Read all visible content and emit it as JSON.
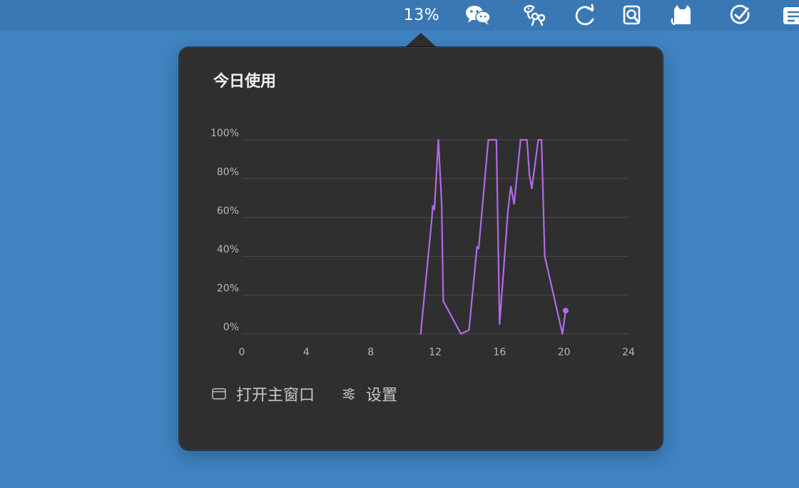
{
  "menubar": {
    "cpu_readout": "13%",
    "icons": [
      "wechat-icon",
      "chatbot-icon",
      "sync-icon",
      "magnifier-icon",
      "cat-icon",
      "checkmark-icon",
      "notes-icon"
    ]
  },
  "popover": {
    "title": "今日使用",
    "actions": {
      "open_main_window": "打开主窗口",
      "settings": "设置"
    }
  },
  "colors": {
    "desktop_bg": "#3f83c1",
    "menubar_bg": "#3a78b5",
    "popover_bg": "#2f2f2f",
    "line": "#b469e8",
    "grid": "#4b4b4b",
    "tick_label": "#b7b7b7"
  },
  "chart_data": {
    "type": "line",
    "title": "今日使用",
    "xlabel": "",
    "ylabel": "",
    "xlim": [
      0,
      24
    ],
    "ylim": [
      0,
      100
    ],
    "xticks": [
      0,
      4,
      8,
      12,
      16,
      20,
      24
    ],
    "ytick_labels": [
      "100%",
      "80%",
      "60%",
      "40%",
      "20%",
      "0%"
    ],
    "yticks": [
      100,
      80,
      60,
      40,
      20,
      0
    ],
    "grid": true,
    "legend": "none",
    "series": [
      {
        "values": [
          [
            11.1,
            0
          ],
          [
            11.8,
            60
          ],
          [
            11.85,
            66
          ],
          [
            11.95,
            64
          ],
          [
            12.2,
            100
          ],
          [
            12.4,
            68
          ],
          [
            12.5,
            17
          ],
          [
            13.6,
            0
          ],
          [
            14.1,
            2
          ],
          [
            14.6,
            45
          ],
          [
            14.7,
            44
          ],
          [
            15.3,
            100
          ],
          [
            15.8,
            100
          ],
          [
            16.0,
            5
          ],
          [
            16.4,
            50
          ],
          [
            16.5,
            62
          ],
          [
            16.7,
            76
          ],
          [
            16.9,
            67
          ],
          [
            17.3,
            100
          ],
          [
            17.7,
            100
          ],
          [
            17.85,
            82
          ],
          [
            18.0,
            75
          ],
          [
            18.4,
            100
          ],
          [
            18.6,
            100
          ],
          [
            18.8,
            40
          ],
          [
            19.9,
            0
          ],
          [
            20.1,
            12
          ]
        ]
      }
    ]
  }
}
